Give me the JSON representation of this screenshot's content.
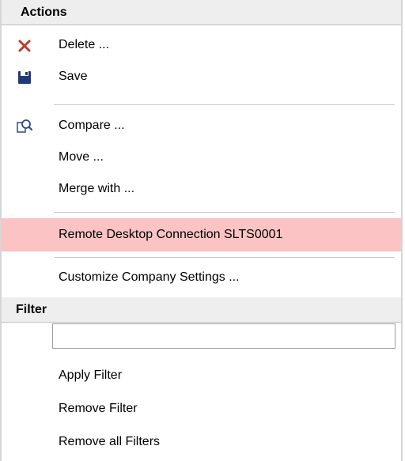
{
  "actions": {
    "header": "Actions",
    "items": [
      {
        "label": "Delete ...",
        "icon": "delete-x-icon"
      },
      {
        "label": "Save",
        "icon": "floppy-disk-icon"
      },
      {
        "label": "Compare ...",
        "icon": "compare-magnifier-icon"
      },
      {
        "label": "Move ..."
      },
      {
        "label": "Merge with ..."
      },
      {
        "label": "Remote Desktop Connection SLTS0001"
      },
      {
        "label": "Customize Company Settings ..."
      }
    ]
  },
  "filter": {
    "header": "Filter",
    "input_value": "",
    "items": [
      {
        "label": "Apply Filter"
      },
      {
        "label": "Remove Filter"
      },
      {
        "label": "Remove all Filters"
      }
    ]
  },
  "colors": {
    "highlight": "#fbc3c3",
    "delete_icon": "#c0392b",
    "save_icon": "#1f3a7a",
    "compare_icon": "#2b4a8c"
  }
}
